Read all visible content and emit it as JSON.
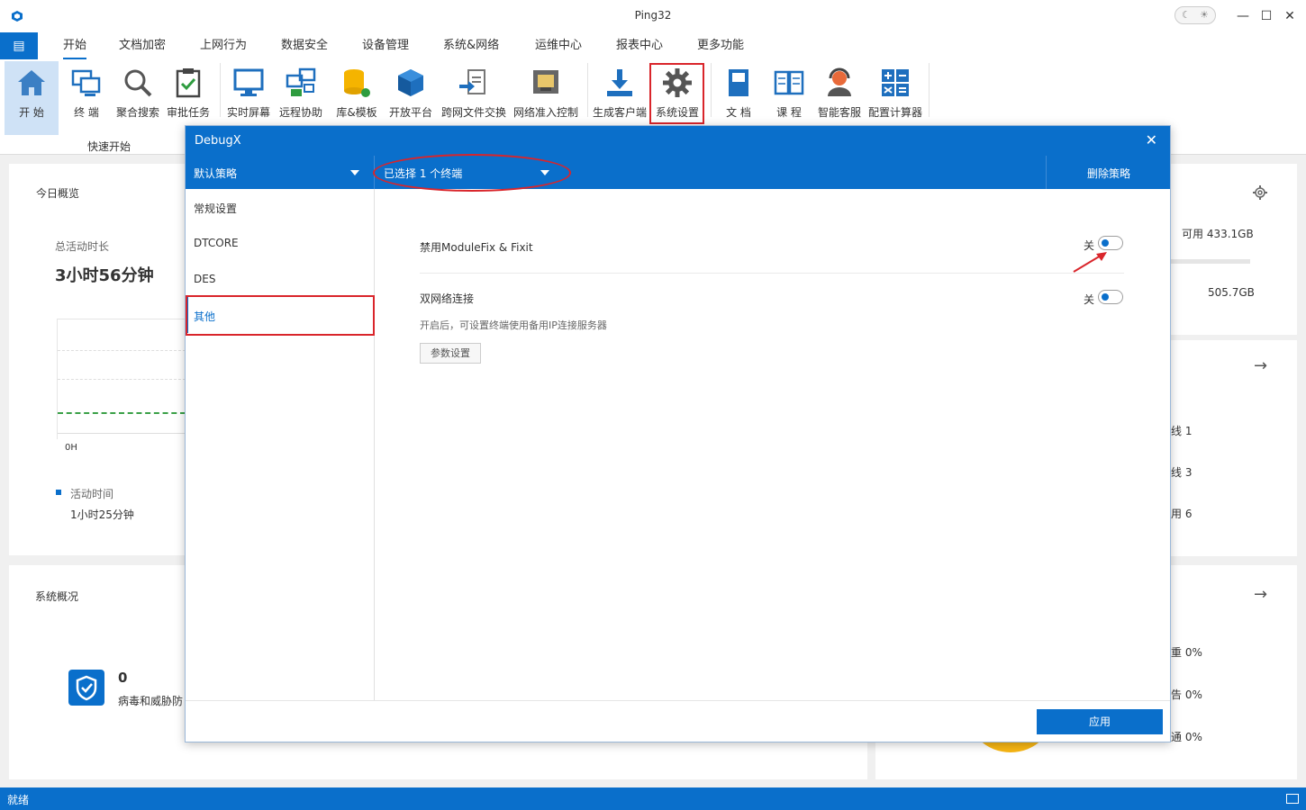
{
  "window": {
    "title": "Ping32",
    "theme_moon": "☾",
    "theme_sun": "☀",
    "minimize": "—",
    "maximize": "☐",
    "close": "✕"
  },
  "menu": {
    "file_icon": "▤",
    "tabs": [
      "开始",
      "文档加密",
      "上网行为",
      "数据安全",
      "设备管理",
      "系统&网络",
      "运维中心",
      "报表中心",
      "更多功能"
    ]
  },
  "ribbon": {
    "group_label": "快速开始",
    "buttons": [
      "开 始",
      "终 端",
      "聚合搜索",
      "审批任务",
      "实时屏幕",
      "远程协助",
      "库&模板",
      "开放平台",
      "跨网文件交换",
      "网络准入控制",
      "生成客户端",
      "系统设置",
      "文 档",
      "课 程",
      "智能客服",
      "配置计算器"
    ]
  },
  "dashboard": {
    "today_title": "今日概览",
    "total_active_label": "总活动时长",
    "total_active_value": "3小时56分钟",
    "chart_x_label": "0H",
    "legend_label": "活动时间",
    "legend_value": "1小时25分钟",
    "system_title": "系统概况",
    "threat_count": "0",
    "threat_label": "病毒和威胁防",
    "disk_available": "可用 433.1GB",
    "disk_total": "505.7GB",
    "online_1": "线  1",
    "online_2": "线  3",
    "online_3": "用  6",
    "pct_1": "重  0%",
    "pct_2": "告  0%",
    "pct_3": "通  0%"
  },
  "dialog": {
    "title": "DebugX",
    "close": "✕",
    "policy": "默认策略",
    "terminals": "已选择 1 个终端",
    "delete_policy": "删除策略",
    "sidebar": [
      "常规设置",
      "DTCORE",
      "DES",
      "其他"
    ],
    "settings": [
      {
        "label": "禁用ModuleFix & Fixit",
        "state": "关"
      },
      {
        "label": "双网络连接",
        "state": "关",
        "desc": "开启后，可设置终端使用备用IP连接服务器",
        "button": "参数设置"
      }
    ],
    "apply": "应用"
  },
  "status": {
    "text": "就绪"
  },
  "colors": {
    "brand": "#0a6fcb",
    "highlight": "#d9252b",
    "active_line": "#3aa047"
  }
}
